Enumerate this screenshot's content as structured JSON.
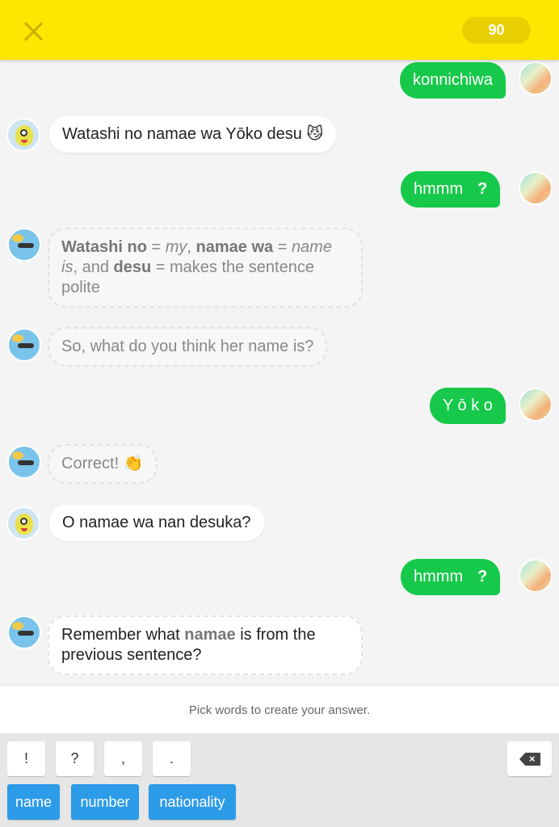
{
  "header": {
    "score": "90",
    "close_icon": "close-icon"
  },
  "messages": {
    "m1": {
      "text": "konnichiwa"
    },
    "m2": {
      "text": "Watashi no namae wa Yōko desu",
      "emoji": "😼"
    },
    "m3": {
      "text": "hmmm",
      "mark": "?"
    },
    "m4": {
      "b1": "Watashi no",
      "t1": " = ",
      "i1": "my",
      "t2": ", ",
      "b2": "namae wa",
      "t3": " = ",
      "i2": "name is",
      "t4": ", and ",
      "b3": "desu",
      "t5": " = makes the sentence polite"
    },
    "m5": {
      "text": "So, what do you think her name is?"
    },
    "m6": {
      "text": "Y ō k o"
    },
    "m7": {
      "text": "Correct!",
      "emoji": "👏"
    },
    "m8": {
      "text": "O namae wa nan desuka?"
    },
    "m9": {
      "text": "hmmm",
      "mark": "?"
    },
    "m10": {
      "t1": "Remember what ",
      "b1": "namae",
      "t2": " is from the previous sentence?"
    }
  },
  "footer": {
    "instruction": "Pick words to create your answer."
  },
  "keyboard": {
    "punctuation": [
      "!",
      "?",
      ",",
      "."
    ],
    "words": [
      "name",
      "number",
      "nationality"
    ],
    "backspace_icon": "backspace-icon"
  },
  "colors": {
    "header": "#ffe600",
    "user_bubble": "#17c94a",
    "word_key": "#2c9be8"
  }
}
